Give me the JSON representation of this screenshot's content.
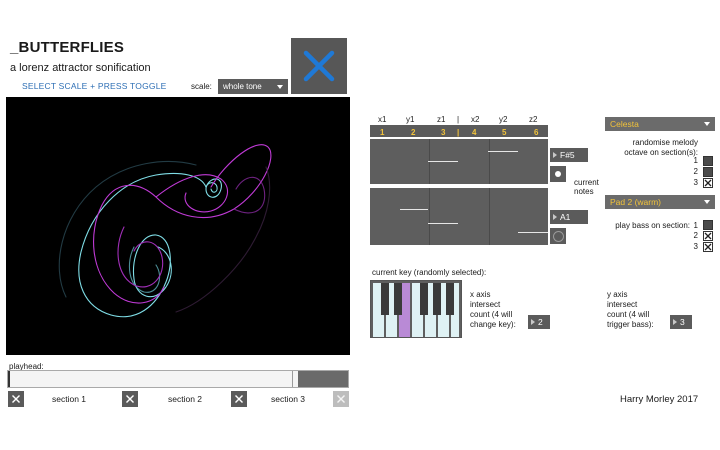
{
  "header": {
    "title": "_BUTTERFLIES",
    "subtitle": "a lorenz attractor sonification",
    "hint": "SELECT SCALE + PRESS TOGGLE",
    "scale_label": "scale:",
    "scale_value": "whole tone"
  },
  "colors": {
    "trail_cyan": "#7fdde6",
    "trail_magenta": "#c03ad6",
    "toggle_x": "#1f79d6",
    "note_yellow": "#f2c33a",
    "key_highlight": "#b98ad6"
  },
  "playhead": {
    "label": "playhead:",
    "sections": [
      {
        "label": "section 1"
      },
      {
        "label": "section 2"
      },
      {
        "label": "section 3"
      }
    ]
  },
  "scopes": {
    "headers": [
      "x1",
      "y1",
      "z1",
      "|",
      "x2",
      "y2",
      "z2"
    ],
    "numbers": [
      "1",
      "2",
      "3",
      "|",
      "4",
      "5",
      "6"
    ],
    "melody_note": "F#5",
    "bass_note": "A1",
    "current_notes_label": [
      "current",
      "notes"
    ]
  },
  "melody": {
    "instrument": "Celesta",
    "randomise_label": [
      "randomise melody",
      "octave on section(s):"
    ],
    "options": [
      {
        "label": "1",
        "checked": false
      },
      {
        "label": "2",
        "checked": false
      },
      {
        "label": "3",
        "checked": true
      }
    ]
  },
  "bass": {
    "instrument": "Pad 2 (warm)",
    "label": "play bass on section:",
    "options": [
      {
        "label": "1",
        "checked": false
      },
      {
        "label": "2",
        "checked": true
      },
      {
        "label": "3",
        "checked": true
      }
    ]
  },
  "key": {
    "label": "current key (randomly selected):",
    "x_axis": [
      "x axis",
      "intersect",
      "count (4 will",
      "change key):"
    ],
    "x_count": "2",
    "y_axis": [
      "y axis",
      "intersect",
      "count (4 will",
      "trigger bass):"
    ],
    "y_count": "3"
  },
  "credit": "Harry Morley 2017"
}
